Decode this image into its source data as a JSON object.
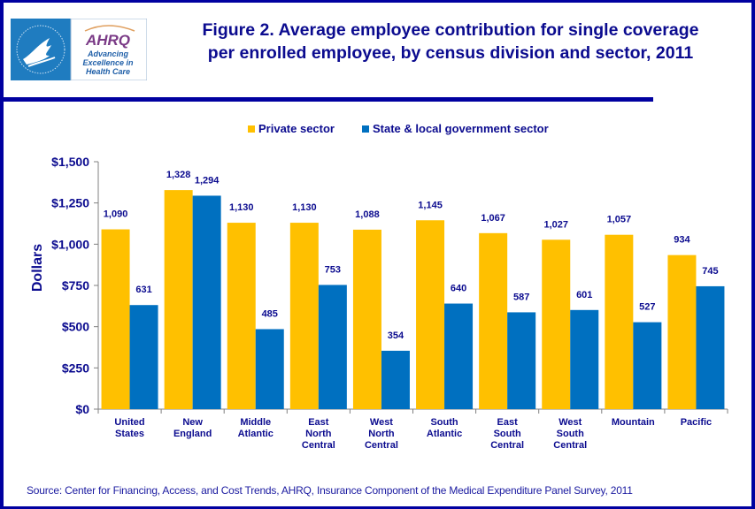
{
  "logo": {
    "org_name": "AHRQ",
    "tagline_lines": [
      "Advancing",
      "Excellence in",
      "Health Care"
    ],
    "hhs_ring_text": "DEPARTMENT OF HEALTH & HUMAN SERVICES USA"
  },
  "title_lines": [
    "Figure 2. Average employee contribution for single coverage",
    "per enrolled employee, by census division and sector, 2011"
  ],
  "source": "Source: Center for Financing, Access, and Cost Trends, AHRQ, Insurance Component of the Medical Expenditure Panel Survey,  2011",
  "colors": {
    "frame": "#0000A0",
    "text": "#0b0b8f",
    "private": "#FFC000",
    "government": "#0070C0",
    "axis": "#808080"
  },
  "chart_data": {
    "type": "bar",
    "title": "Figure 2. Average employee contribution for single coverage per enrolled employee, by census division and sector, 2011",
    "xlabel": "",
    "ylabel": "Dollars",
    "ylim": [
      0,
      1500
    ],
    "yticks": [
      0,
      250,
      500,
      750,
      1000,
      1250,
      1500
    ],
    "ytick_labels": [
      "$0",
      "$250",
      "$500",
      "$750",
      "$1,000",
      "$1,250",
      "$1,500"
    ],
    "grid": false,
    "legend_position": "top-center",
    "categories": [
      [
        "United",
        "States"
      ],
      [
        "New",
        "England"
      ],
      [
        "Middle",
        "Atlantic"
      ],
      [
        "East",
        "North",
        "Central"
      ],
      [
        "West",
        "North",
        "Central"
      ],
      [
        "South",
        "Atlantic"
      ],
      [
        "East",
        "South",
        "Central"
      ],
      [
        "West",
        "South",
        "Central"
      ],
      [
        "Mountain"
      ],
      [
        "Pacific"
      ]
    ],
    "series": [
      {
        "name": "Private sector",
        "color": "#FFC000",
        "values": [
          1090,
          1328,
          1130,
          1130,
          1088,
          1145,
          1067,
          1027,
          1057,
          934
        ],
        "labels": [
          "1,090",
          "1,328",
          "1,130",
          "1,130",
          "1,088",
          "1,145",
          "1,067",
          "1,027",
          "1,057",
          "934"
        ]
      },
      {
        "name": "State & local government sector",
        "color": "#0070C0",
        "values": [
          631,
          1294,
          485,
          753,
          354,
          640,
          587,
          601,
          527,
          745
        ],
        "labels": [
          "631",
          "1,294",
          "485",
          "753",
          "354",
          "640",
          "587",
          "601",
          "527",
          "745"
        ]
      }
    ]
  }
}
